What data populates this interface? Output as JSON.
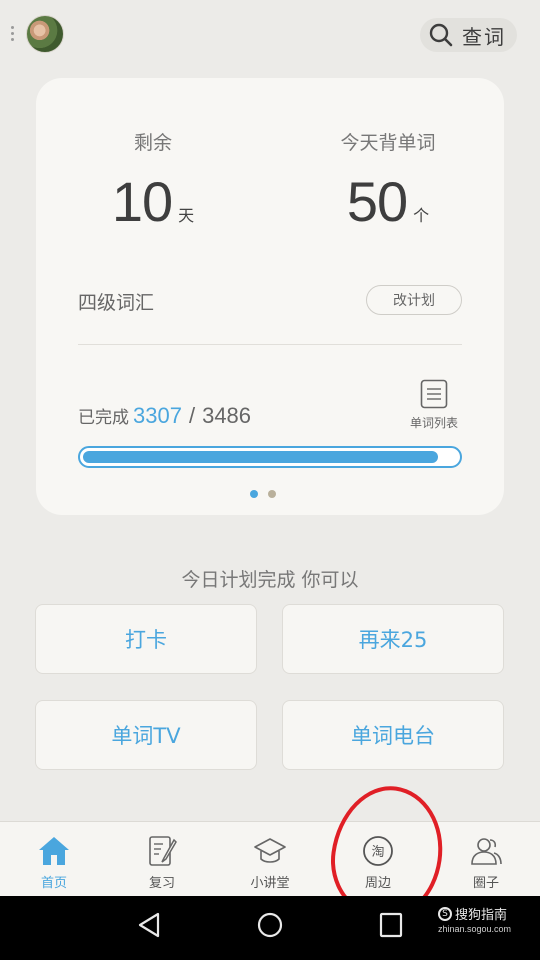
{
  "header": {
    "search_label": "查词",
    "icons": {
      "menu": "more-vertical-icon",
      "search": "search-icon"
    }
  },
  "card": {
    "remaining": {
      "label": "剩余",
      "value": "10",
      "unit": "天"
    },
    "today": {
      "label": "今天背单词",
      "value": "50",
      "unit": "个"
    },
    "vocab_name": "四级词汇",
    "change_plan": "改计划",
    "progress": {
      "label": "已完成",
      "done": "3307",
      "separator": "/",
      "total": "3486",
      "fraction": 0.949
    },
    "word_list_label": "单词列表",
    "page_indicator": {
      "count": 2,
      "active_index": 0
    }
  },
  "plan": {
    "title": "今日计划完成 你可以",
    "actions": [
      "打卡",
      "再来25",
      "单词TV",
      "单词电台"
    ]
  },
  "bottom_nav": {
    "items": [
      {
        "label": "首页",
        "icon": "home-icon",
        "active": true
      },
      {
        "label": "复习",
        "icon": "edit-notebook-icon",
        "active": false
      },
      {
        "label": "小讲堂",
        "icon": "graduation-cap-icon",
        "active": false
      },
      {
        "label": "周边",
        "icon": "taobao-shop-icon",
        "active": false
      },
      {
        "label": "圈子",
        "icon": "people-icon",
        "active": false
      }
    ]
  },
  "watermark": {
    "text": "搜狗指南",
    "logo": "S",
    "url": "zhinan.sogou.com"
  },
  "colors": {
    "accent": "#4aa6de",
    "background": "#ecebe8",
    "card": "#f8f7f4",
    "annotation": "#e01f26"
  }
}
